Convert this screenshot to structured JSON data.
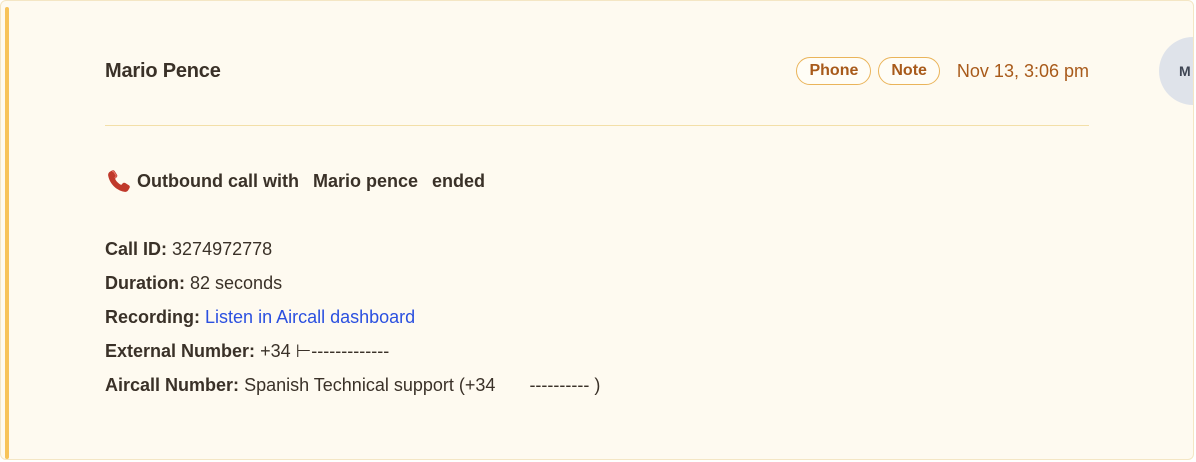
{
  "author": "Mario Pence",
  "tags": [
    "Phone",
    "Note"
  ],
  "timestamp": "Nov 13, 3:06 pm",
  "avatar_initial": "M",
  "call": {
    "prefix": "Outbound call with",
    "contact": "Mario pence",
    "suffix": "ended",
    "icon": "phone-icon"
  },
  "details": [
    {
      "label": "Call ID:",
      "value": "3274972778"
    },
    {
      "label": "Duration:",
      "value": "82 seconds"
    },
    {
      "label": "Recording:",
      "value": "Listen in Aircall dashboard",
      "is_link": true
    },
    {
      "label": "External Number:",
      "value": "+34 ⊢-------------"
    },
    {
      "label": "Aircall Number:",
      "value": "Spanish Technical support (+34",
      "value_tail": "---------- )"
    }
  ],
  "colors": {
    "accent": "#f7c35a",
    "tag_border": "#eab45a",
    "tag_text": "#a85a1a",
    "link": "#2b50e0",
    "card_bg": "#fefaf0"
  }
}
